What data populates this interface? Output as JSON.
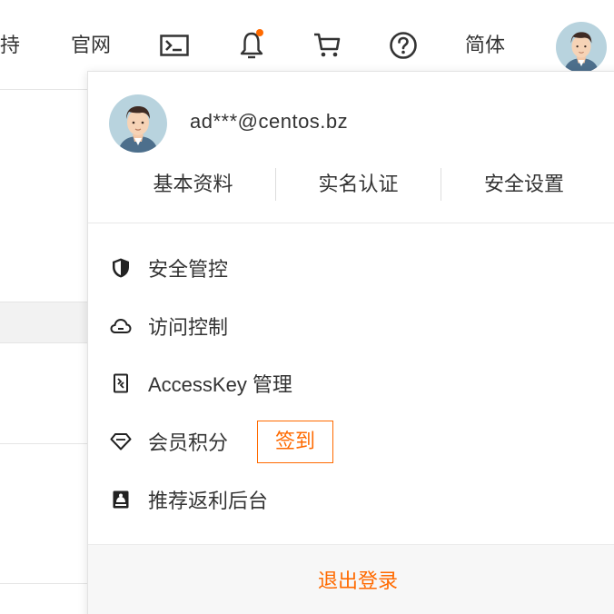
{
  "topbar": {
    "support_partial": "持",
    "official_site": "官网",
    "language": "简体",
    "icons": [
      "terminal-icon",
      "bell-icon",
      "cart-icon",
      "help-icon"
    ],
    "accent": "#ff6a00"
  },
  "account": {
    "email": "ad***@centos.bz",
    "tabs": [
      {
        "label": "基本资料"
      },
      {
        "label": "实名认证"
      },
      {
        "label": "安全设置"
      }
    ]
  },
  "menu": [
    {
      "label": "安全管控",
      "icon": "shield-icon"
    },
    {
      "label": "访问控制",
      "icon": "cloud-icon"
    },
    {
      "label": "AccessKey 管理",
      "icon": "key-icon"
    },
    {
      "label": "会员积分",
      "icon": "diamond-icon"
    },
    {
      "label": "推荐返利后台",
      "icon": "referral-icon"
    }
  ],
  "signin_label": "签到",
  "logout_label": "退出登录"
}
